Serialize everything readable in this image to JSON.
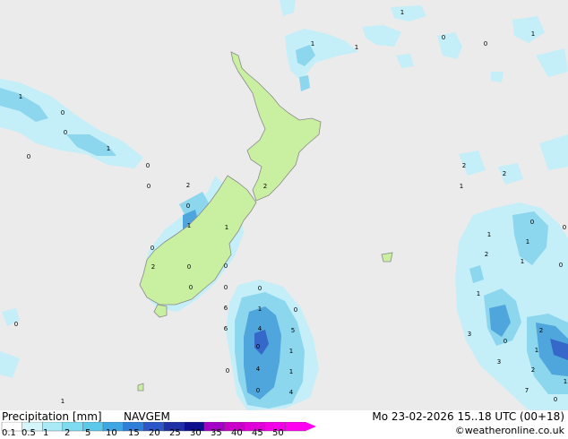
{
  "header": {
    "title": "Precipitation [mm]",
    "model": "NAVGEM",
    "datetime": "Mo 23-02-2026 15..18 UTC (00+18)",
    "credit": "©weatheronline.co.uk"
  },
  "legend": {
    "ticks": [
      "0.1",
      "0.5",
      "1",
      "2",
      "5",
      "10",
      "15",
      "20",
      "25",
      "30",
      "35",
      "40",
      "45",
      "50"
    ],
    "colors": [
      "#ffffff",
      "#d6f5fb",
      "#a9eaf6",
      "#7fdcf0",
      "#5cc8ea",
      "#3fa6e4",
      "#2f7ed8",
      "#2b55c8",
      "#1e2fa8",
      "#0c108e",
      "#a400c8",
      "#c800c8",
      "#e000d8",
      "#f200e8",
      "#ff00f0"
    ]
  },
  "colors": {
    "sea": "#ebebeb",
    "land": "#c8f0a0",
    "coast": "#8a8a8a",
    "precip_light": "#c4eef8",
    "precip_mid": "#8cd6ee",
    "precip_heavy": "#4fa6dc",
    "precip_core": "#3568c8"
  },
  "map_labels": [
    {
      "text": "1"
    },
    {
      "text": "0"
    },
    {
      "text": "0"
    },
    {
      "text": "1"
    },
    {
      "text": "1"
    },
    {
      "text": "1"
    },
    {
      "text": "1"
    },
    {
      "text": "0"
    },
    {
      "text": "0"
    },
    {
      "text": "1"
    },
    {
      "text": "0"
    },
    {
      "text": "0"
    },
    {
      "text": "0"
    },
    {
      "text": "2"
    },
    {
      "text": "2"
    },
    {
      "text": "2"
    },
    {
      "text": "1"
    },
    {
      "text": "2"
    },
    {
      "text": "0"
    },
    {
      "text": "0"
    },
    {
      "text": "1"
    },
    {
      "text": "1"
    },
    {
      "text": "0"
    },
    {
      "text": "0"
    },
    {
      "text": "1"
    },
    {
      "text": "1"
    },
    {
      "text": "2"
    },
    {
      "text": "1"
    },
    {
      "text": "0"
    },
    {
      "text": "2"
    },
    {
      "text": "0"
    },
    {
      "text": "0"
    },
    {
      "text": "0"
    },
    {
      "text": "0"
    },
    {
      "text": "0"
    },
    {
      "text": "1"
    },
    {
      "text": "0"
    },
    {
      "text": "6"
    },
    {
      "text": "1"
    },
    {
      "text": "0"
    },
    {
      "text": "6"
    },
    {
      "text": "4"
    },
    {
      "text": "5"
    },
    {
      "text": "3"
    },
    {
      "text": "0"
    },
    {
      "text": "0"
    },
    {
      "text": "1"
    },
    {
      "text": "2"
    },
    {
      "text": "4"
    },
    {
      "text": "1"
    },
    {
      "text": "1"
    },
    {
      "text": "0"
    },
    {
      "text": "3"
    },
    {
      "text": "4"
    },
    {
      "text": "2"
    },
    {
      "text": "1"
    },
    {
      "text": "7"
    },
    {
      "text": "1"
    },
    {
      "text": "0"
    },
    {
      "text": "0"
    },
    {
      "text": "0"
    }
  ]
}
